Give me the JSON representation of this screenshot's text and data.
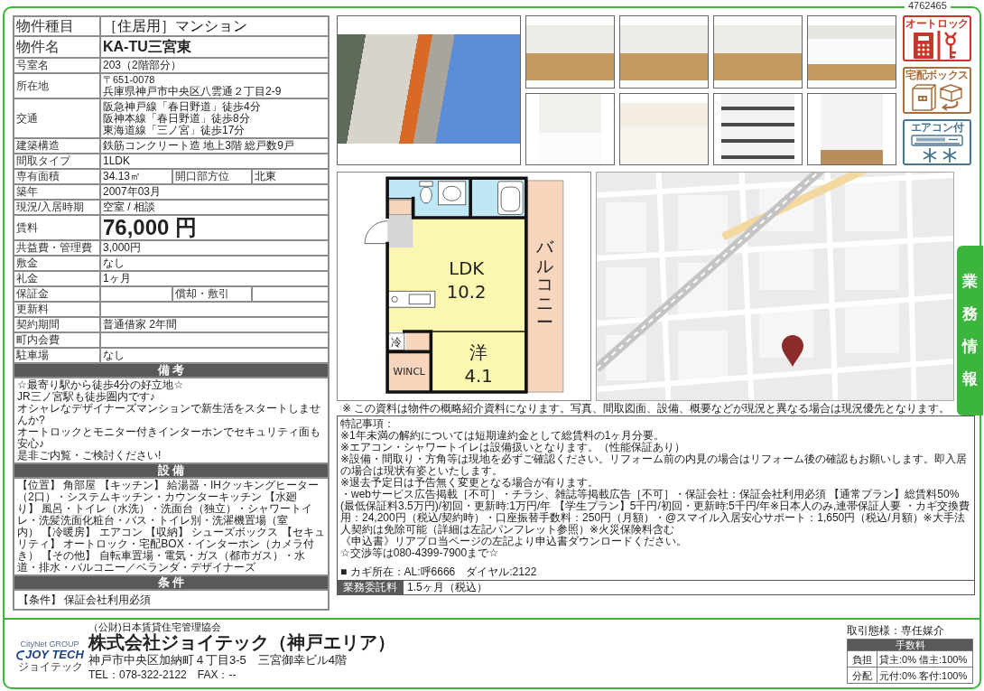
{
  "listing_id": "4762465",
  "property_table": {
    "rows": [
      {
        "kind": "title",
        "label": "物件種目",
        "value": "［住居用］マンション"
      },
      {
        "kind": "name",
        "label": "物件名",
        "value": "KA-TU三宮東"
      },
      {
        "kind": "plain",
        "label": "号室名",
        "value": "203（2階部分）"
      },
      {
        "kind": "address",
        "label": "所在地",
        "postal": "〒651-0078",
        "value": "兵庫県神戸市中央区八雲通２丁目2-9"
      },
      {
        "kind": "lines",
        "label": "交通",
        "lines": [
          "阪急神戸線「春日野道」徒歩4分",
          "阪神本線「春日野道」徒歩8分",
          "東海道線「三ノ宮」徒歩17分"
        ]
      },
      {
        "kind": "plain",
        "label": "建築構造",
        "value": "鉄筋コンクリート造 地上3階 総戸数9戸"
      },
      {
        "kind": "plain",
        "label": "間取タイプ",
        "value": "1LDK"
      },
      {
        "kind": "split",
        "label": "専有面積",
        "value": "34.13㎡",
        "label_2": "開口部方位",
        "value_2": "北東"
      },
      {
        "kind": "plain",
        "label": "築年",
        "value": "2007年03月"
      },
      {
        "kind": "plain",
        "label": "現況/入居時期",
        "value": "空室 / 相談"
      },
      {
        "kind": "rent",
        "label": "賃料",
        "value": "76,000 円"
      },
      {
        "kind": "plain",
        "label": "共益費・管理費",
        "value": "3,000円"
      },
      {
        "kind": "plain",
        "label": "敷金",
        "value": "なし"
      },
      {
        "kind": "plain",
        "label": "礼金",
        "value": "1ヶ月"
      },
      {
        "kind": "split",
        "label": "保証金",
        "label_2": "償却・敷引"
      },
      {
        "kind": "plain",
        "label": "更新料"
      },
      {
        "kind": "plain",
        "label": "契約期間",
        "value": "普通借家 2年間"
      },
      {
        "kind": "plain",
        "label": "町内会費"
      },
      {
        "kind": "plain",
        "label": "駐車場",
        "value": "なし"
      }
    ]
  },
  "remarks": {
    "title": "備 考",
    "lines": [
      "☆最寄り駅から徒歩4分の好立地☆",
      "JR三ノ宮駅も徒歩圏内です♪",
      "オシャレなデザイナーズマンションで新生活をスタートしませんか?",
      "オートロックとモニター付きインターホンでセキュリティ面も安心♪",
      "是非ご内覧・ご検討ください!"
    ]
  },
  "equipment": {
    "title": "設 備",
    "text": "【位置】 角部屋 【キッチン】 給湯器・IHクッキングヒーター（2口）・システムキッチン・カウンターキッチン 【水廻り】 風呂・トイレ（水洗）・洗面台（独立）・シャワートイレ・洗髪洗面化粧台・バス・トイレ別・洗濯機置場（室内） 【冷暖房】 エアコン 【収納】 シューズボックス 【セキュリティ】 オートロック・宅配BOX・インターホン（カメラ付き） 【その他】 自転車置場・電気・ガス（都市ガス）・水道・排水・バルコニー／ベランダ・デザイナーズ"
  },
  "conditions": {
    "title": "条 件",
    "text": "【条件】 保証会社利用必須"
  },
  "photos": [
    {
      "kind": "exterior"
    },
    {
      "kind": "room"
    },
    {
      "kind": "room"
    },
    {
      "kind": "room"
    },
    {
      "kind": "kitchen"
    },
    {
      "kind": "toilet"
    },
    {
      "kind": "bath"
    },
    {
      "kind": "shelf"
    },
    {
      "kind": "closet"
    }
  ],
  "feature_badges": [
    {
      "kind": "autolock",
      "label": "オートロック"
    },
    {
      "kind": "delivery_box",
      "label": "宅配ボックス"
    },
    {
      "kind": "aircon",
      "label": "エアコン付"
    }
  ],
  "floor_plan": {
    "rooms": [
      {
        "kind": "ldk",
        "label": "LDK",
        "size": "10.2"
      },
      {
        "kind": "balcony",
        "label": "バルコニー"
      },
      {
        "kind": "fridge",
        "label": "冷"
      },
      {
        "kind": "closet",
        "label": "WINCL"
      },
      {
        "kind": "western",
        "label": "洋",
        "size": "4.1"
      }
    ]
  },
  "side_tab": {
    "label": "業務情報"
  },
  "disclaimer": "※ この資料は物件の概略紹介資料になります。写真、間取図面、設備、概要などが現況と異なる場合は現況優先となります。",
  "special_notes": {
    "title": "特記事項：",
    "lines": [
      "※1年未満の解約については短期違約金として総賃料の1ヶ月分要。",
      "※エアコン・シャワートイレは設備扱いとなります。（性能保証あり）",
      "※設備・間取り・方角等は現地を必ずご確認ください。リフォーム前の内見の場合はリフォーム後の確認もお願いします。即入居の場合は現状有姿といたします。",
      "※退去予定日は予告無く変更となる場合が有ります。",
      "・webサービス広告掲載［不可］・チラシ、雑誌等掲載広告［不可］・保証会社：保証会社利用必須 【通常プラン】総賃料50%(最低保証料3.5万円)/初回・更新時:1万円/年 【学生プラン】5千円/初回・更新時:5千円/年※日本人のみ,連帯保証人要 ・カギ交換費用：24,200円（税込/契約時）・口座振替手数料：250円（月額）・@スマイル入居安心サポート：1,650円（税込/月額）※大手法人契約は免除可能（詳細は左記パンフレット参照）※火災保険料含む",
      "《申込書》リアプロ当ページの左記より申込書ダウンロードください。",
      "☆交渉等は080-4399-7900まで☆"
    ],
    "key_info": "■ カギ所在：AL:呼6666　ダイヤル:2122"
  },
  "fee": {
    "label": "業務委託料",
    "value": "1.5ヶ月（税込）"
  },
  "footer": {
    "logo": {
      "group": "CityNet GROUP",
      "name": "JOY TECH",
      "kana": "ジョイテック"
    },
    "association": "（公財)日本賃貸住宅管理協会",
    "company": "株式会社ジョイテック（神戸エリア）",
    "address": "神戸市中央区加納町４丁目3-5　三宮御幸ビル4階",
    "contact": "TEL：078-322-2122　FAX：--",
    "transaction": "取引態様：専任媒介",
    "commission": {
      "title": "手数料",
      "rows": [
        {
          "label": "負担",
          "value": "貸主:0% 借主:100%"
        },
        {
          "label": "分配",
          "value": "元付:0% 客付:100%"
        }
      ]
    }
  }
}
